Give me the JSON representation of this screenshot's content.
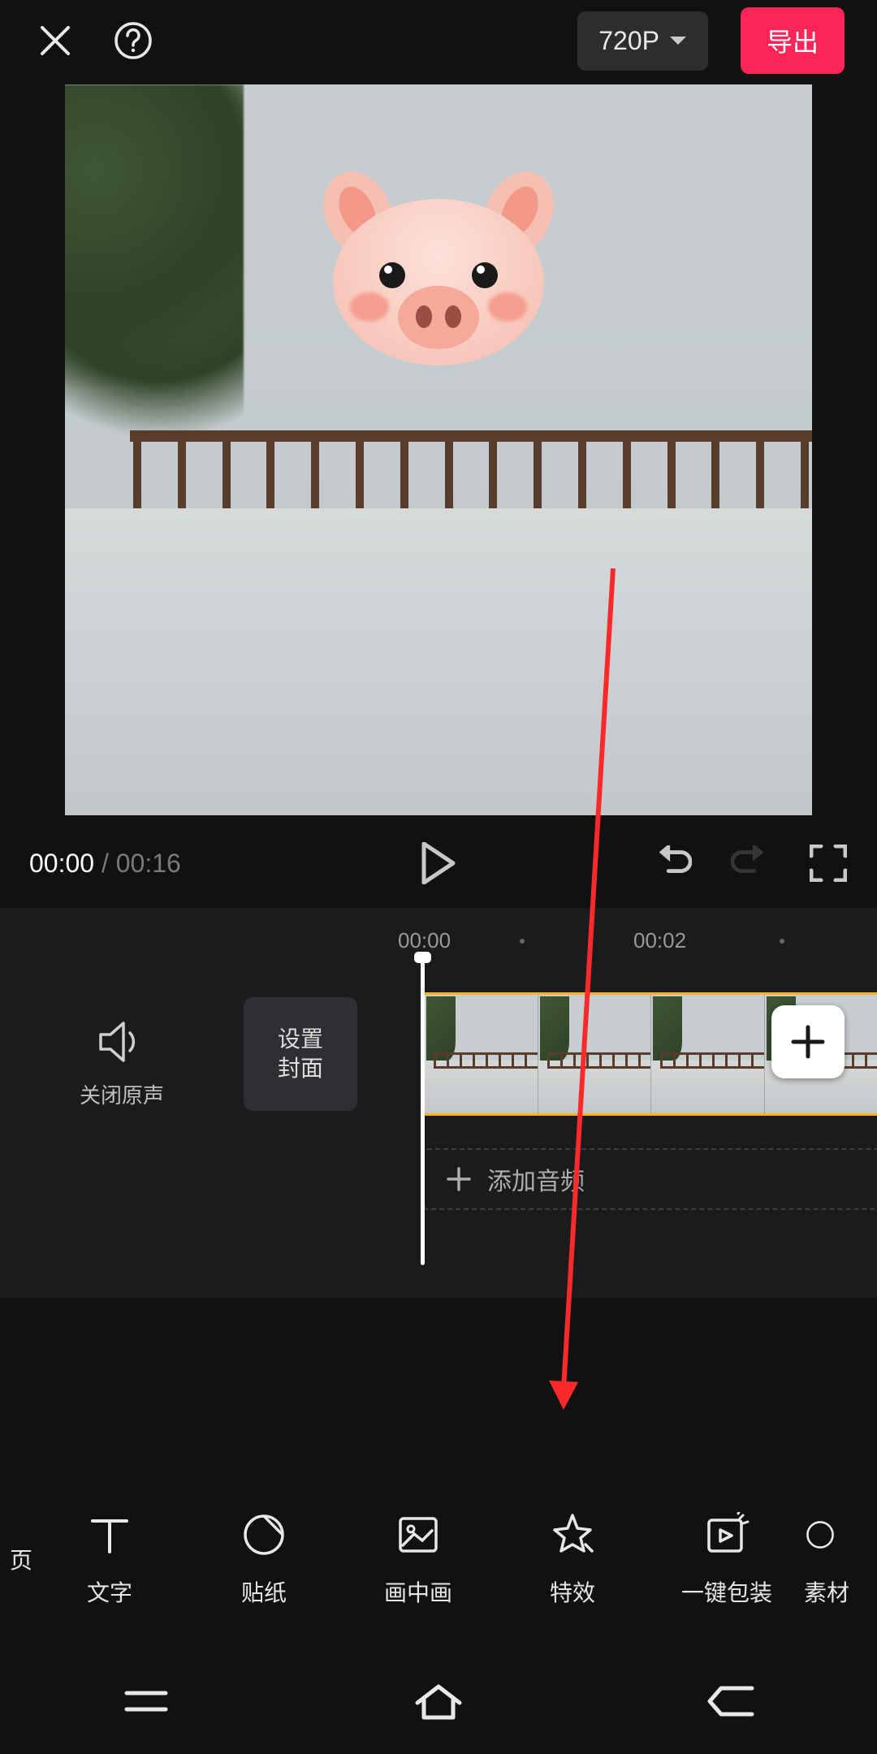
{
  "header": {
    "resolution": "720P",
    "export": "导出"
  },
  "playback": {
    "current": "00:00",
    "separator": " / ",
    "duration": "00:16"
  },
  "timeline": {
    "ticks": [
      "00:00",
      "00:02"
    ],
    "mute_label": "关闭原声",
    "cover_label": "设置\n封面",
    "add_audio": "添加音频"
  },
  "tools": [
    {
      "id": "text",
      "label": "文字",
      "icon": "text-icon"
    },
    {
      "id": "sticker",
      "label": "贴纸",
      "icon": "sticker-icon"
    },
    {
      "id": "pip",
      "label": "画中画",
      "icon": "pip-icon"
    },
    {
      "id": "effects",
      "label": "特效",
      "icon": "effects-icon"
    },
    {
      "id": "package",
      "label": "一键包装",
      "icon": "package-icon"
    },
    {
      "id": "material",
      "label": "素材",
      "icon": "material-icon"
    }
  ],
  "partial_left_label": "页"
}
